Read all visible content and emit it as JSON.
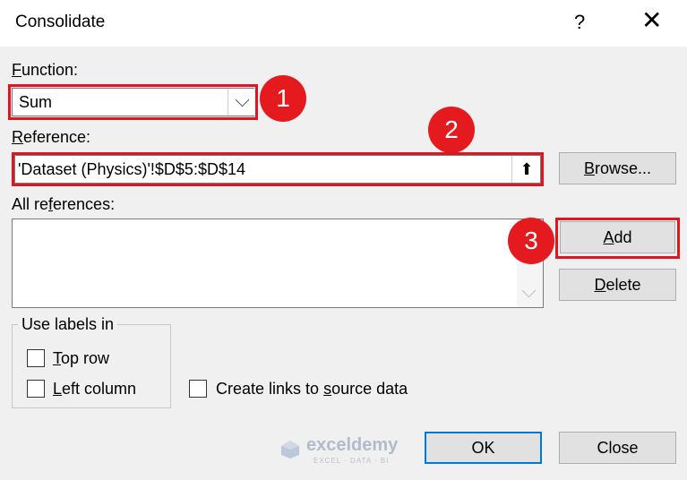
{
  "dialog": {
    "title": "Consolidate",
    "help_glyph": "?",
    "close_glyph": "✕"
  },
  "function": {
    "label": "Function:",
    "label_key": "F",
    "label_rest": "unction:",
    "value": "Sum"
  },
  "reference": {
    "label_key": "R",
    "label_rest": "eference:",
    "value": "'Dataset (Physics)'!$D$5:$D$14",
    "collapse_glyph": "⬆"
  },
  "all_references": {
    "label_pre": "All re",
    "label_key": "f",
    "label_rest": "erences:"
  },
  "buttons": {
    "browse_key": "B",
    "browse_rest": "rowse...",
    "add_key": "A",
    "add_rest": "dd",
    "delete_key": "D",
    "delete_rest": "elete",
    "ok": "OK",
    "close": "Close"
  },
  "use_labels": {
    "legend": "Use labels in",
    "top_row_key": "T",
    "top_row_rest": "op row",
    "left_col_key": "L",
    "left_col_rest": "eft column",
    "links_pre": "Create links to ",
    "links_key": "s",
    "links_rest": "ource data"
  },
  "markers": [
    "1",
    "2",
    "3"
  ],
  "watermark": {
    "name": "exceldemy",
    "tagline": "EXCEL · DATA · BI"
  },
  "colors": {
    "highlight": "#e0161f",
    "marker": "#e51a1f",
    "default_button_border": "#0078d7"
  }
}
